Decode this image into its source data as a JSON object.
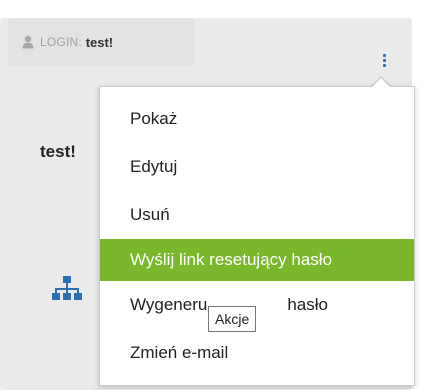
{
  "login_tab": {
    "label": "LOGIN",
    "value": "test!"
  },
  "user": {
    "name_partial": "test!",
    "suffix": "t"
  },
  "menu": {
    "items": [
      {
        "label": "Pokaż"
      },
      {
        "label": "Edytuj"
      },
      {
        "label": "Usuń"
      },
      {
        "label": "Wyślij link resetujący hasło",
        "active": true
      },
      {
        "label": "Wygeneruj nowe hasło"
      },
      {
        "label": "Zmień e-mail"
      }
    ],
    "visible_item5_left": "Wygeneru",
    "visible_item5_right": "hasło"
  },
  "tooltip": {
    "text": "Akcje"
  },
  "colors": {
    "accent": "#7ab82b",
    "link": "#2a6fb0",
    "card": "#eaeaea"
  },
  "icons": {
    "user": "user-icon",
    "kebab": "vertical-ellipsis-icon",
    "tree": "sitemap-icon"
  }
}
